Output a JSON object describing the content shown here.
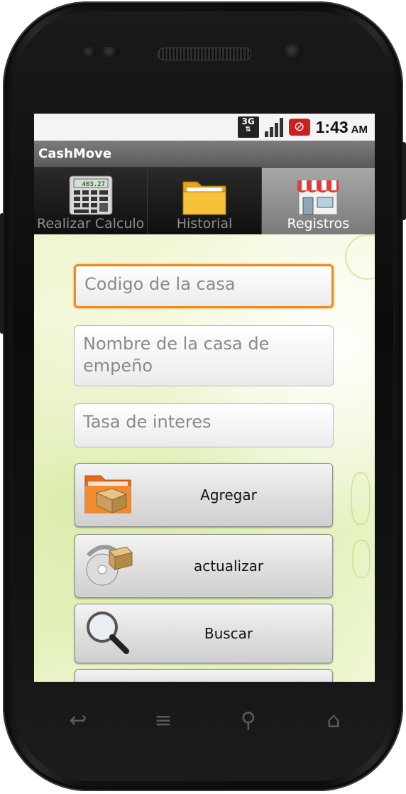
{
  "status_bar": {
    "network": "3G",
    "time": "1:43",
    "ampm": "AM"
  },
  "app": {
    "title": "CashMove"
  },
  "tabs": [
    {
      "label": "Realizar Calculo",
      "icon": "calculator-icon",
      "active": false
    },
    {
      "label": "Historial",
      "icon": "folder-icon",
      "active": false
    },
    {
      "label": "Registros",
      "icon": "store-icon",
      "active": true
    }
  ],
  "form": {
    "codigo_placeholder": "Codigo de la casa",
    "nombre_placeholder": "Nombre de la casa de empeño",
    "tasa_placeholder": "Tasa de interes"
  },
  "buttons": {
    "agregar": "Agregar",
    "actualizar": "actualizar",
    "buscar": "Buscar"
  },
  "colors": {
    "focus_border": "#f08a1c",
    "title_bar": "#6b6b6b",
    "active_tab": "#9a9a9a"
  }
}
